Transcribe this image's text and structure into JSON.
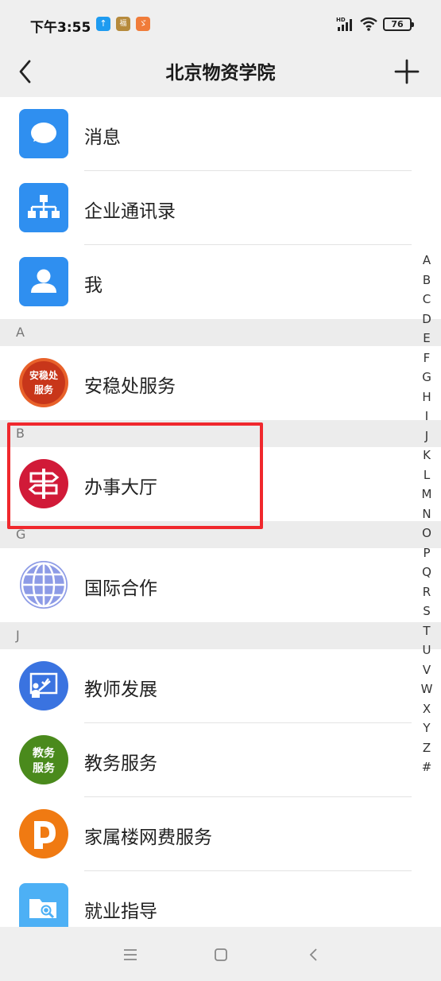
{
  "status_bar": {
    "time": "下午3:55",
    "app_icons": [
      "↑",
      "福",
      "ゞ"
    ],
    "signal": "HD",
    "battery": "76"
  },
  "header": {
    "title": "北京物资学院"
  },
  "top_items": [
    {
      "label": "消息",
      "icon": "chat-bubble-icon"
    },
    {
      "label": "企业通讯录",
      "icon": "org-chart-icon"
    },
    {
      "label": "我",
      "icon": "person-icon"
    }
  ],
  "sections": {
    "A": {
      "letter": "A",
      "items": [
        {
          "label": "安稳处服务",
          "icon_text": [
            "安稳处",
            "服务"
          ]
        }
      ]
    },
    "B": {
      "letter": "B",
      "items": [
        {
          "label": "办事大厅",
          "icon": "signpost-icon"
        }
      ]
    },
    "G": {
      "letter": "G",
      "items": [
        {
          "label": "国际合作",
          "icon": "globe-icon"
        }
      ]
    },
    "J": {
      "letter": "J",
      "items": [
        {
          "label": "教师发展",
          "icon": "teacher-board-icon"
        },
        {
          "label": "教务服务",
          "icon_text": [
            "教务",
            "服务"
          ]
        },
        {
          "label": "家属楼网费服务",
          "icon": "d-logo-icon"
        },
        {
          "label": "就业指导",
          "icon": "folder-search-icon"
        }
      ]
    }
  },
  "alpha_index": [
    "A",
    "B",
    "C",
    "D",
    "E",
    "F",
    "G",
    "H",
    "I",
    "J",
    "K",
    "L",
    "M",
    "N",
    "O",
    "P",
    "Q",
    "R",
    "S",
    "T",
    "U",
    "V",
    "W",
    "X",
    "Y",
    "Z",
    "#"
  ],
  "colors": {
    "accent_blue": "#2f8ff0",
    "highlight_red": "#f0282d",
    "section_bg": "#ececec"
  }
}
